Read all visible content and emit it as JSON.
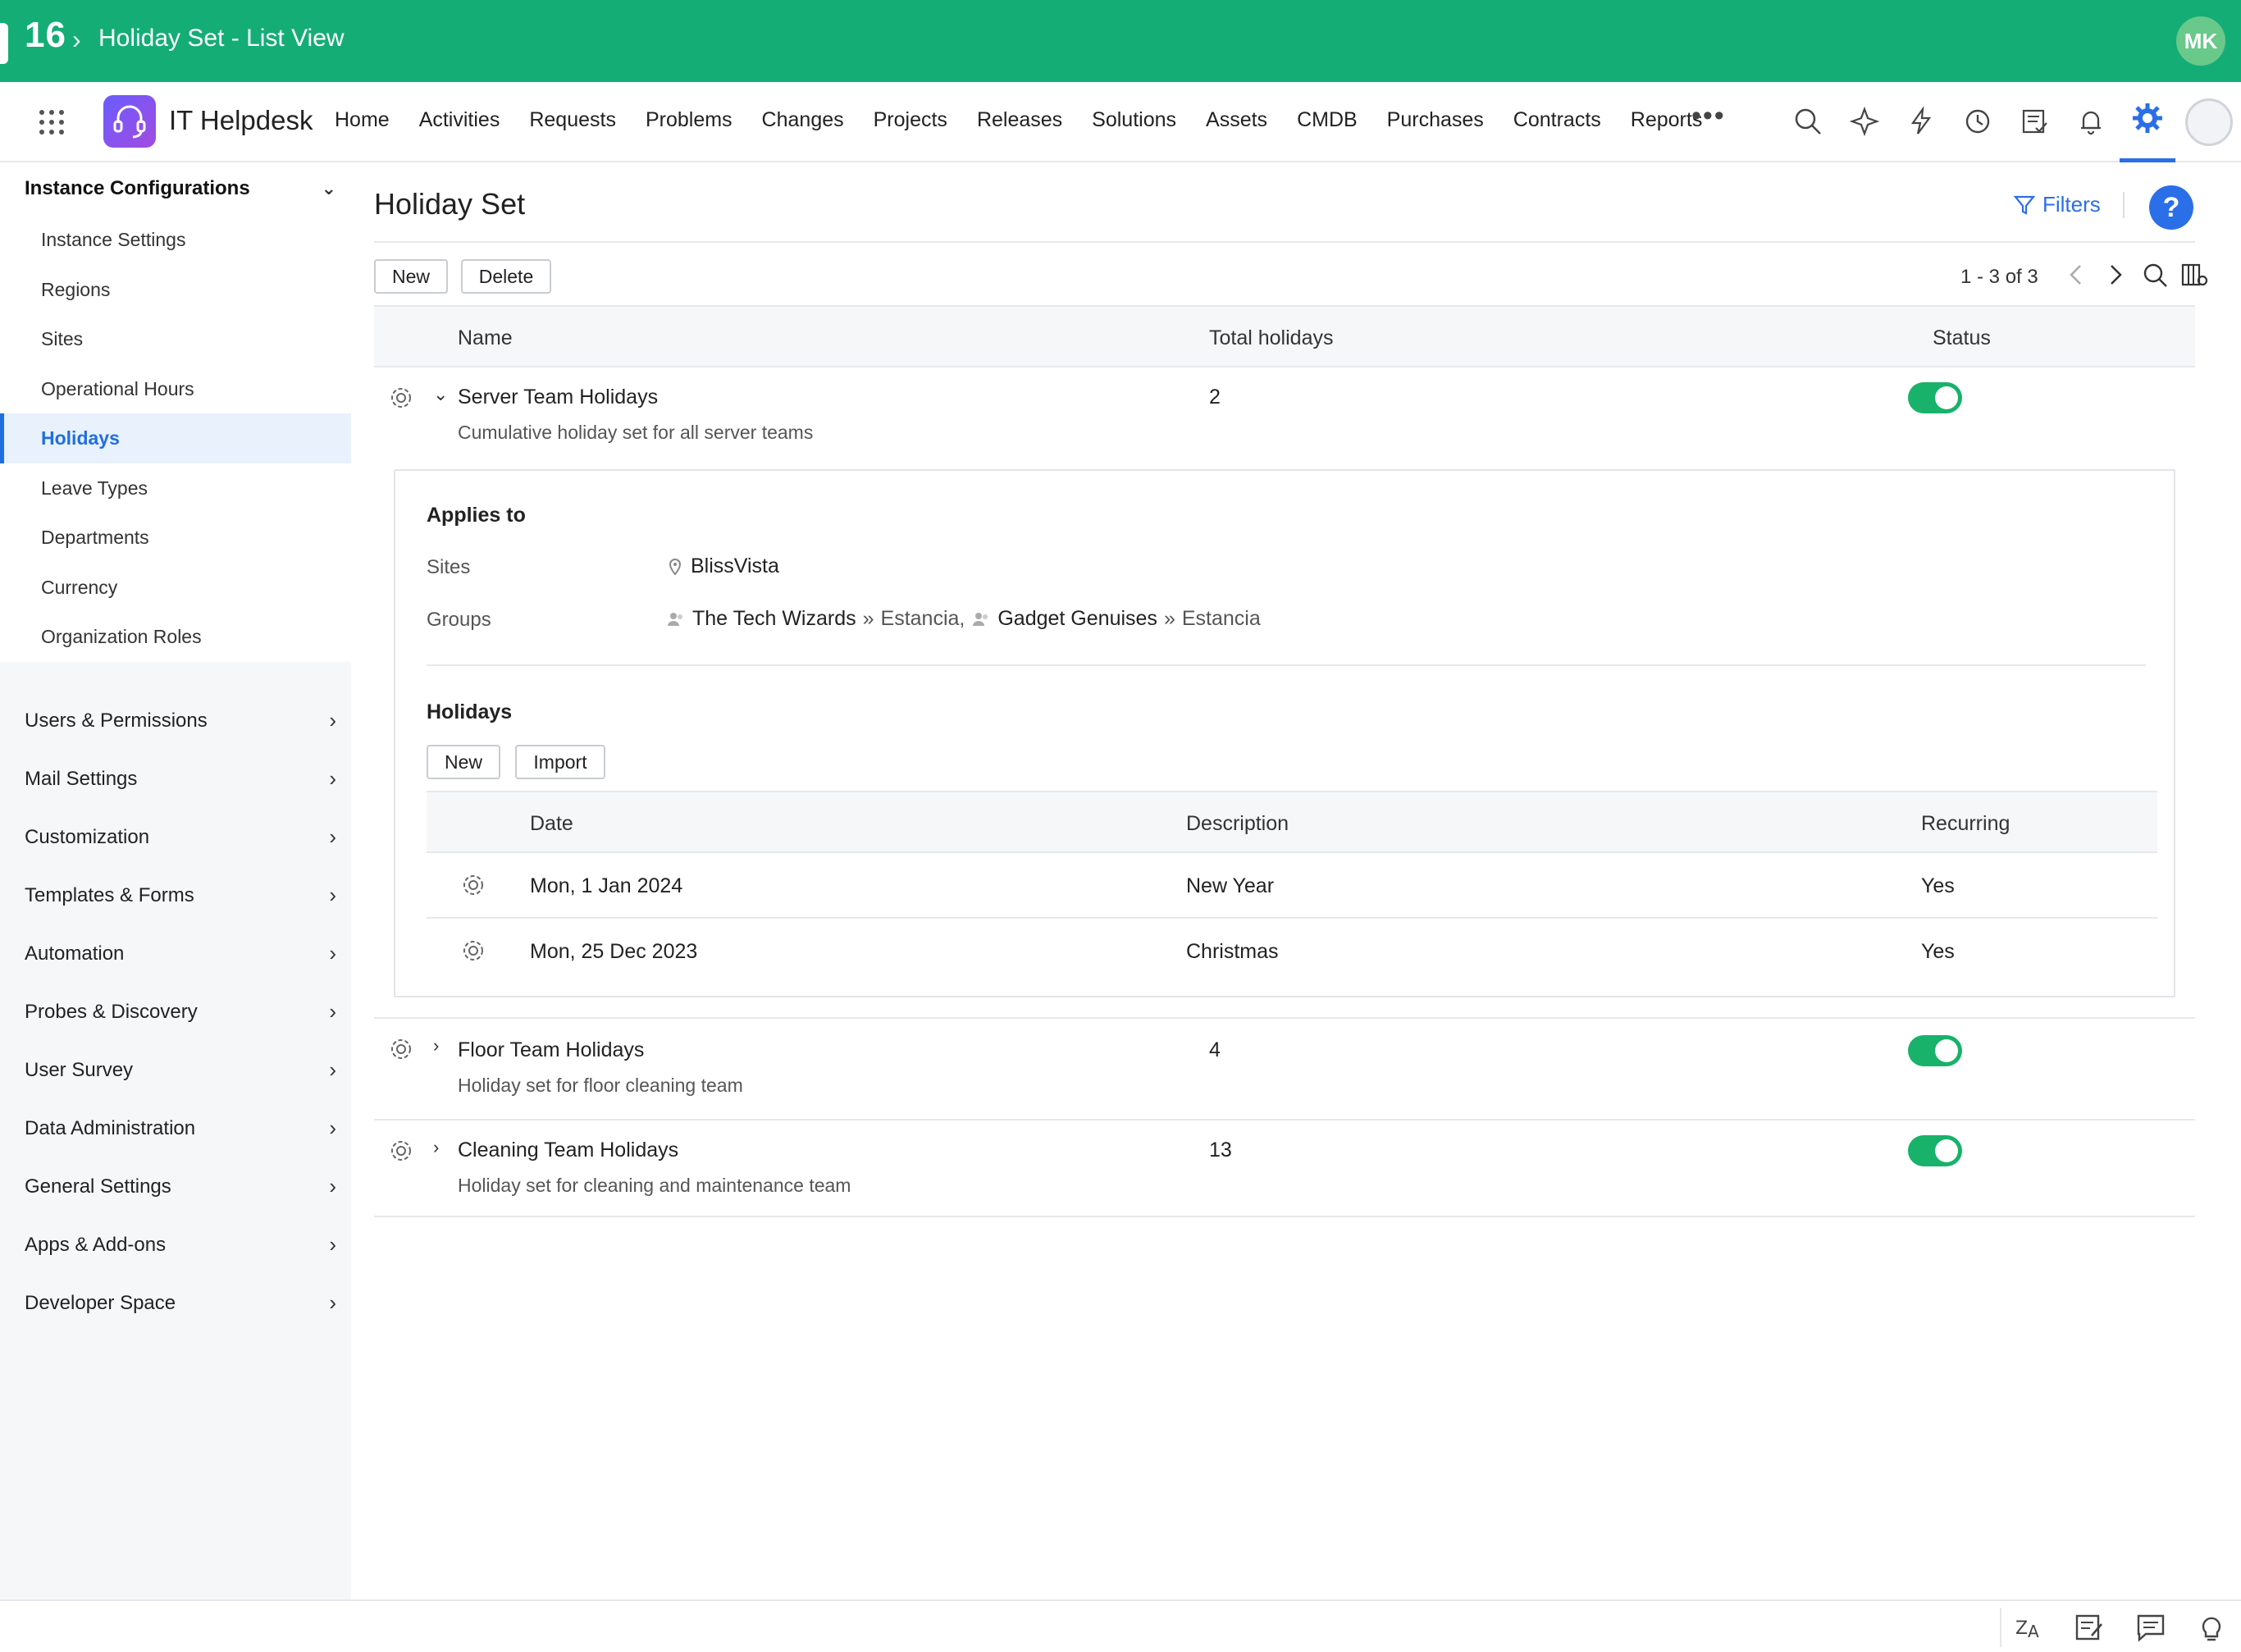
{
  "topbar": {
    "number": "16",
    "title": "Holiday Set - List View",
    "user_initials": "MK"
  },
  "navbar": {
    "app_name": "IT Helpdesk",
    "links": [
      "Home",
      "Activities",
      "Requests",
      "Problems",
      "Changes",
      "Projects",
      "Releases",
      "Solutions",
      "Assets",
      "CMDB",
      "Purchases",
      "Contracts",
      "Reports"
    ],
    "more": "•••"
  },
  "sidebar": {
    "section_title": "Instance Configurations",
    "items": [
      "Instance Settings",
      "Regions",
      "Sites",
      "Operational Hours",
      "Holidays",
      "Leave Types",
      "Departments",
      "Currency",
      "Organization Roles"
    ],
    "active_item": "Holidays",
    "groups": [
      "Users & Permissions",
      "Mail Settings",
      "Customization",
      "Templates & Forms",
      "Automation",
      "Probes & Discovery",
      "User Survey",
      "Data Administration",
      "General Settings",
      "Apps & Add-ons",
      "Developer Space"
    ]
  },
  "main": {
    "title": "Holiday Set",
    "filters_label": "Filters",
    "help_label": "?",
    "buttons": {
      "new": "New",
      "delete": "Delete"
    },
    "pager": "1 - 3 of 3",
    "columns": {
      "name": "Name",
      "total": "Total holidays",
      "status": "Status"
    },
    "rows": [
      {
        "name": "Server Team Holidays",
        "description": "Cumulative holiday set for all server teams",
        "total": "2",
        "status_on": true
      },
      {
        "name": "Floor Team Holidays",
        "description": "Holiday set for floor cleaning team",
        "total": "4",
        "status_on": true
      },
      {
        "name": "Cleaning Team Holidays",
        "description": "Holiday set for cleaning and maintenance team",
        "total": "13",
        "status_on": true
      }
    ],
    "detail": {
      "applies_to_label": "Applies to",
      "sites_label": "Sites",
      "sites_value": "BlissVista",
      "groups_label": "Groups",
      "groups": [
        {
          "name": "The Tech Wizards",
          "site": "Estancia,"
        },
        {
          "name": "Gadget Genuises",
          "site": "Estancia"
        }
      ],
      "holidays_label": "Holidays",
      "new_button": "New",
      "import_button": "Import",
      "columns": {
        "date": "Date",
        "description": "Description",
        "recurring": "Recurring"
      },
      "holidays": [
        {
          "date": "Mon, 1 Jan 2024",
          "description": "New Year",
          "recurring": "Yes"
        },
        {
          "date": "Mon, 25 Dec 2023",
          "description": "Christmas",
          "recurring": "Yes"
        }
      ]
    }
  },
  "colors": {
    "brand_green": "#14ad76",
    "accent_blue": "#2a6fe8",
    "toggle_green": "#18b26a"
  }
}
